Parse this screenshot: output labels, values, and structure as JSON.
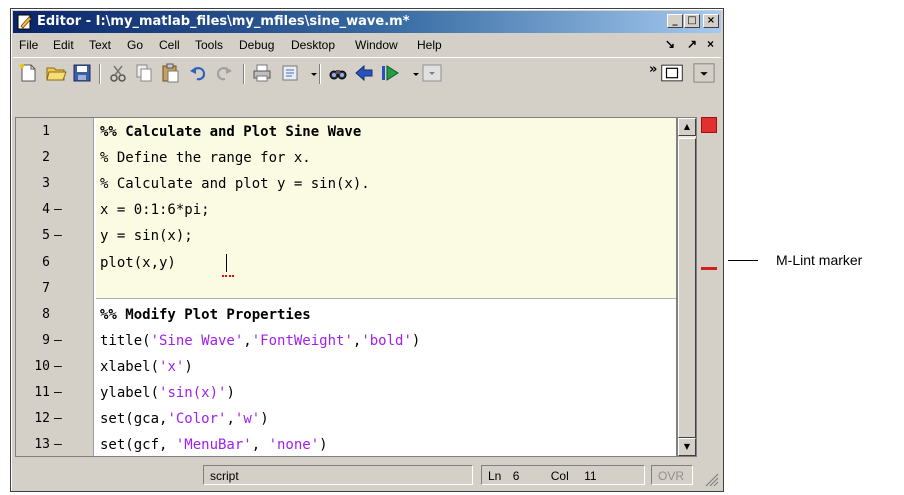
{
  "window": {
    "title": "Editor - I:\\my_matlab_files\\my_mfiles\\sine_wave.m*",
    "caption_buttons": [
      "_",
      "□",
      "×"
    ]
  },
  "menu": {
    "items": [
      "File",
      "Edit",
      "Text",
      "Go",
      "Cell",
      "Tools",
      "Debug",
      "Desktop",
      "Window",
      "Help"
    ],
    "right_controls": [
      "↘",
      "↗",
      "×"
    ]
  },
  "toolbar": {
    "icons": [
      "new-file-icon",
      "open-folder-icon",
      "save-icon",
      "cut-icon",
      "copy-icon",
      "paste-icon",
      "undo-icon",
      "redo-icon",
      "print-icon",
      "list-icon",
      "find-icon",
      "go-back-icon",
      "go-forward-icon",
      "stack-dropdown-icon"
    ],
    "overflow": "»"
  },
  "editor": {
    "lines": [
      {
        "n": "1",
        "dash": "",
        "code": "%% Calculate and Plot Sine Wave",
        "style": "cell"
      },
      {
        "n": "2",
        "dash": "",
        "code": "% Define the range for x.",
        "style": "cmt"
      },
      {
        "n": "3",
        "dash": "",
        "code": "% Calculate and plot y = sin(x).",
        "style": "cmt"
      },
      {
        "n": "4",
        "dash": "–",
        "code": "x = 0:1:6*pi;",
        "style": "plain"
      },
      {
        "n": "5",
        "dash": "–",
        "code": "y = sin(x);",
        "style": "plain"
      },
      {
        "n": "6",
        "dash": "",
        "code": "plot(x,y)",
        "style": "plain"
      },
      {
        "n": "7",
        "dash": "",
        "code": "",
        "style": "plain"
      },
      {
        "n": "8",
        "dash": "",
        "code": "%% Modify Plot Properties",
        "style": "cell"
      },
      {
        "n": "9",
        "dash": "–",
        "code_parts": [
          [
            "title(",
            "plain"
          ],
          [
            "'Sine Wave'",
            "str"
          ],
          [
            ",",
            "plain"
          ],
          [
            "'FontWeight'",
            "str"
          ],
          [
            ",",
            "plain"
          ],
          [
            "'bold'",
            "str"
          ],
          [
            ")",
            "plain"
          ]
        ]
      },
      {
        "n": "10",
        "dash": "–",
        "code_parts": [
          [
            "xlabel(",
            "plain"
          ],
          [
            "'x'",
            "str"
          ],
          [
            ")",
            "plain"
          ]
        ]
      },
      {
        "n": "11",
        "dash": "–",
        "code_parts": [
          [
            "ylabel(",
            "plain"
          ],
          [
            "'sin(x)'",
            "str"
          ],
          [
            ")",
            "plain"
          ]
        ]
      },
      {
        "n": "12",
        "dash": "–",
        "code_parts": [
          [
            "set(gca,",
            "plain"
          ],
          [
            "'Color'",
            "str"
          ],
          [
            ",",
            "plain"
          ],
          [
            "'w'",
            "str"
          ],
          [
            ")",
            "plain"
          ]
        ]
      },
      {
        "n": "13",
        "dash": "–",
        "code_parts": [
          [
            "set(gcf, ",
            "plain"
          ],
          [
            "'MenuBar'",
            "str"
          ],
          [
            ", ",
            "plain"
          ],
          [
            "'none'",
            "str"
          ],
          [
            ")",
            "plain"
          ]
        ]
      }
    ]
  },
  "status": {
    "mode": "script",
    "ln_label": "Ln",
    "ln_value": "6",
    "col_label": "Col",
    "col_value": "11",
    "ovr": "OVR"
  },
  "annotation": {
    "label": "M-Lint marker"
  },
  "colors": {
    "cell_highlight": "#fbfbe3",
    "comment": "#228b22",
    "string": "#a020f0",
    "mlint_marker": "#d02020"
  }
}
